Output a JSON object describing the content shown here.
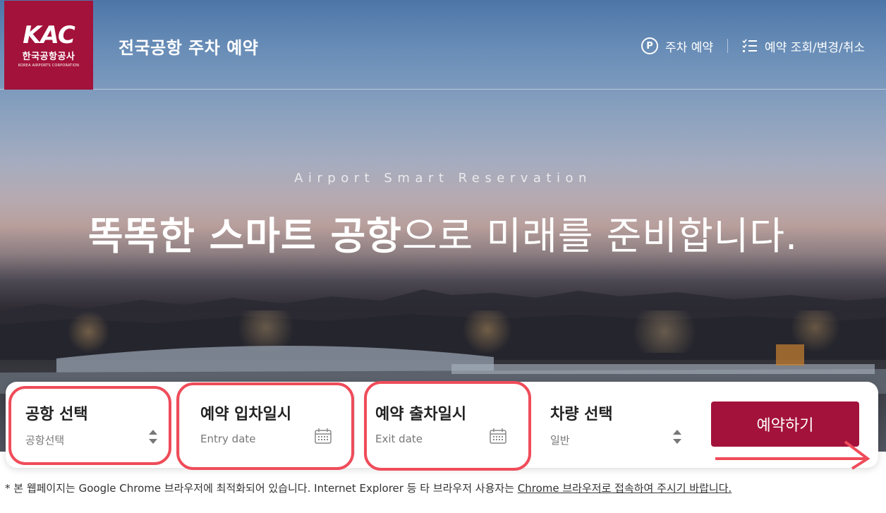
{
  "header": {
    "logo_mark": "KAC",
    "logo_korean": "한국공항공사",
    "logo_english": "KOREA AIRPORTS CORPORATION",
    "site_title": "전국공항 주차 예약",
    "nav": [
      {
        "label": "주차 예약",
        "icon": "parking-icon"
      },
      {
        "label": "예약 조회/변경/취소",
        "icon": "list-check-icon"
      }
    ]
  },
  "hero": {
    "subtitle": "Airport Smart Reservation",
    "headline_bold": "똑똑한 스마트 공항",
    "headline_light": "으로 미래를 준비합니다."
  },
  "reservation_form": {
    "airport": {
      "title": "공항 선택",
      "value": "공항선택"
    },
    "entry": {
      "title": "예약 입차일시",
      "placeholder": "Entry date"
    },
    "exit": {
      "title": "예약 출차일시",
      "placeholder": "Exit date"
    },
    "vehicle": {
      "title": "차량 선택",
      "value": "일반"
    },
    "submit_label": "예약하기"
  },
  "notice": {
    "text": "* 본 웹페이지는 Google Chrome 브라우저에 최적화되어 있습니다. Internet Explorer 등 타 브라우저 사용자는 ",
    "link": "Chrome 브라우저로 접속하여 주시기 바랍니다."
  },
  "colors": {
    "brand": "#a3123a",
    "annotation": "#ef4c5a"
  }
}
